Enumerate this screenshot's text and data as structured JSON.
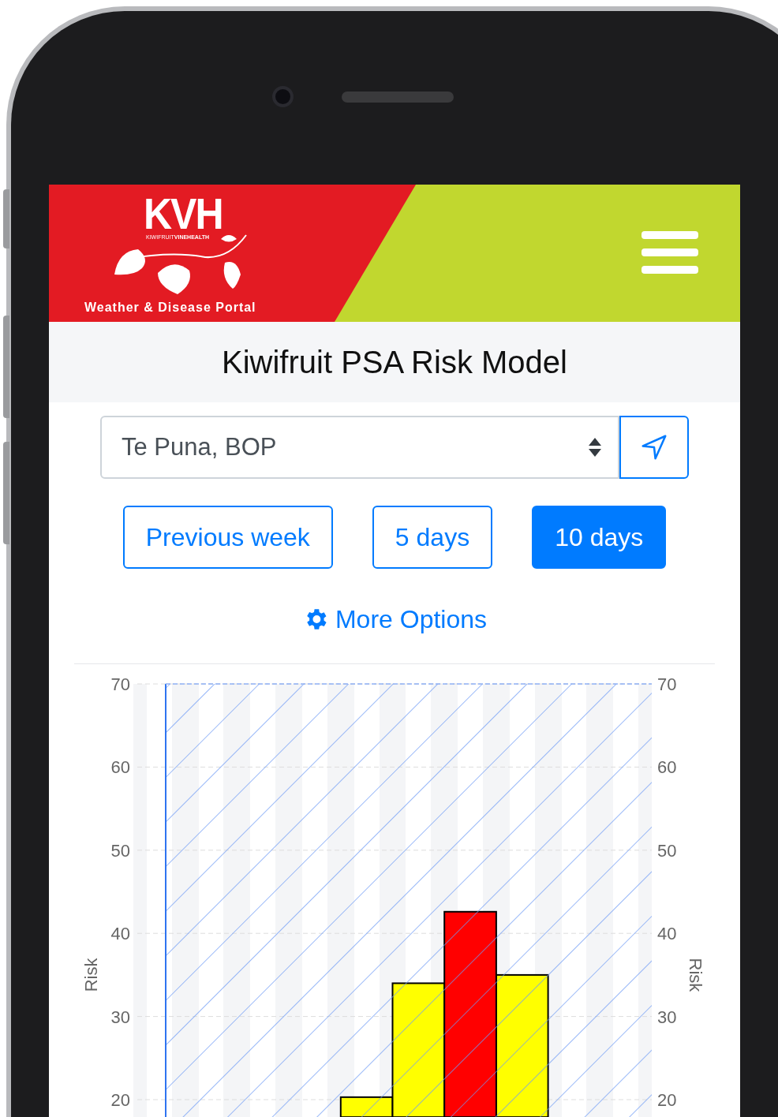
{
  "header": {
    "logo": {
      "wordmark": "KVH",
      "tagline": "KIWIFRUIT**VINEHEALTH**",
      "subtitle": "Weather & Disease Portal"
    }
  },
  "title": "Kiwifruit PSA Risk Model",
  "location": {
    "value": "Te Puna, BOP"
  },
  "periods": [
    {
      "label": "Previous week",
      "selected": false
    },
    {
      "label": "5 days",
      "selected": false
    },
    {
      "label": "10 days",
      "selected": true
    }
  ],
  "more_options": {
    "label": "More Options"
  },
  "chart": {
    "chart_data": {
      "type": "bar",
      "ylabel": "Risk",
      "y2label": "Risk",
      "ylim": [
        17.9,
        70
      ],
      "y2lim": [
        17.9,
        70
      ],
      "grid": true,
      "yticks": [
        20,
        30,
        40,
        50,
        60,
        70
      ],
      "y2ticks": [
        20,
        30,
        40,
        50,
        60,
        70
      ],
      "series": [
        {
          "color": "#ffff00",
          "values": [
            null,
            null,
            null,
            null,
            20.3,
            34,
            null,
            35,
            null,
            null
          ]
        },
        {
          "color": "#ff0000",
          "values": [
            null,
            null,
            null,
            null,
            null,
            null,
            42.6,
            null,
            null,
            null
          ]
        }
      ]
    }
  }
}
